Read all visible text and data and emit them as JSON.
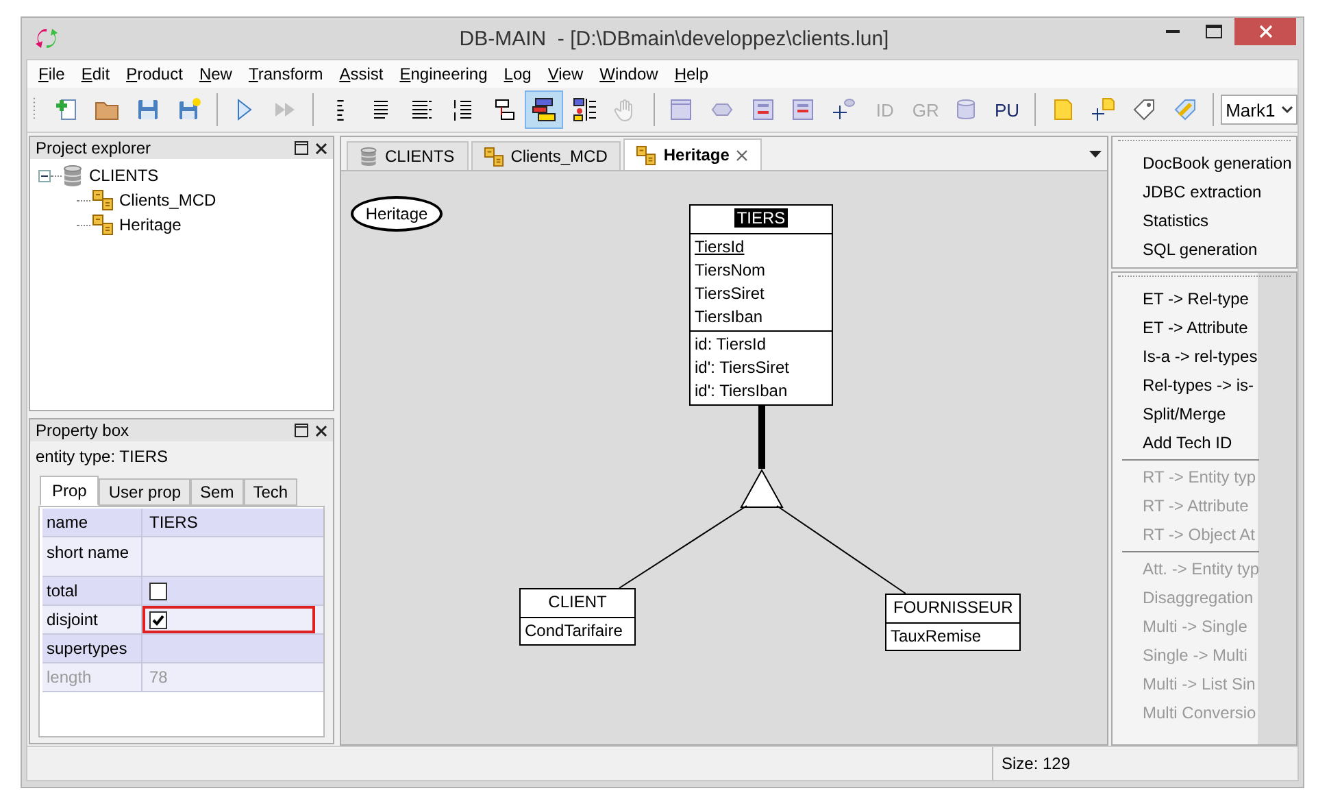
{
  "window": {
    "title": "DB-MAIN  - [D:\\DBmain\\developpez\\clients.lun]"
  },
  "menu": [
    "File",
    "Edit",
    "Product",
    "New",
    "Transform",
    "Assist",
    "Engineering",
    "Log",
    "View",
    "Window",
    "Help"
  ],
  "toolbar": {
    "groups": [
      {
        "buttons": [
          {
            "kind": "icon",
            "selected": false,
            "disabled": false
          },
          {
            "kind": "icon",
            "selected": false,
            "disabled": false
          },
          {
            "kind": "icon",
            "selected": false,
            "disabled": false
          },
          {
            "kind": "icon",
            "selected": false,
            "disabled": false
          }
        ]
      },
      {
        "buttons": [
          {
            "kind": "icon",
            "selected": false,
            "disabled": false
          },
          {
            "kind": "icon",
            "selected": false,
            "disabled": true
          }
        ]
      },
      {
        "buttons": [
          {
            "kind": "icon",
            "selected": false,
            "disabled": false
          },
          {
            "kind": "icon",
            "selected": false,
            "disabled": false
          },
          {
            "kind": "icon",
            "selected": false,
            "disabled": false
          },
          {
            "kind": "icon",
            "selected": false,
            "disabled": false
          },
          {
            "kind": "icon",
            "selected": false,
            "disabled": false
          },
          {
            "kind": "icon",
            "selected": true,
            "disabled": false
          },
          {
            "kind": "icon",
            "selected": false,
            "disabled": false
          },
          {
            "kind": "icon",
            "selected": false,
            "disabled": true
          }
        ]
      },
      {
        "buttons": [
          {
            "kind": "icon",
            "selected": false,
            "disabled": false
          },
          {
            "kind": "icon",
            "selected": false,
            "disabled": false
          },
          {
            "kind": "icon",
            "selected": false,
            "disabled": false
          },
          {
            "kind": "icon",
            "selected": false,
            "disabled": false
          },
          {
            "kind": "icon",
            "selected": false,
            "disabled": false
          },
          {
            "kind": "text",
            "label": "ID",
            "selected": false,
            "disabled": true
          },
          {
            "kind": "text",
            "label": "GR",
            "selected": false,
            "disabled": true
          },
          {
            "kind": "icon",
            "selected": false,
            "disabled": false
          },
          {
            "kind": "text",
            "label": "PU",
            "selected": false,
            "disabled": false
          }
        ]
      },
      {
        "buttons": [
          {
            "kind": "icon",
            "selected": false,
            "disabled": false
          },
          {
            "kind": "icon",
            "selected": false,
            "disabled": false
          },
          {
            "kind": "icon",
            "selected": false,
            "disabled": false
          },
          {
            "kind": "icon",
            "selected": false,
            "disabled": false
          }
        ]
      }
    ],
    "mark_select": {
      "value": "Mark1"
    }
  },
  "project_explorer": {
    "title": "Project explorer",
    "tree": [
      {
        "label": "CLIENTS",
        "expanded": true,
        "children": [
          {
            "label": "Clients_MCD"
          },
          {
            "label": "Heritage"
          }
        ]
      }
    ]
  },
  "property_box": {
    "title": "Property box",
    "subject": "entity type: TIERS",
    "tabs": [
      {
        "label": "Prop",
        "selected": true
      },
      {
        "label": "User prop",
        "selected": false
      },
      {
        "label": "Sem",
        "selected": false
      },
      {
        "label": "Tech",
        "selected": false
      }
    ],
    "rows": [
      {
        "kind": "text",
        "name": "name",
        "value": "TIERS",
        "disabled": false,
        "focused": false
      },
      {
        "kind": "text",
        "name": "short name",
        "disabled": false,
        "focused": false
      },
      {
        "kind": "checkbox",
        "name": "total",
        "checked": false,
        "disabled": false,
        "focused": false
      },
      {
        "kind": "checkbox",
        "name": "disjoint",
        "checked": true,
        "disabled": false,
        "focused": true
      },
      {
        "kind": "text",
        "name": "supertypes",
        "disabled": false,
        "focused": false
      },
      {
        "kind": "text",
        "name": "length",
        "value": "78",
        "disabled": true,
        "focused": false
      }
    ]
  },
  "document_tabs": [
    {
      "kind": "database",
      "label": "CLIENTS",
      "selected": false
    },
    {
      "kind": "schema",
      "label": "Clients_MCD",
      "selected": false
    },
    {
      "kind": "schema",
      "label": "Heritage",
      "selected": true
    }
  ],
  "diagram": {
    "schema_label": "Heritage",
    "entities": [
      {
        "name": "TIERS",
        "selected": true,
        "attributes": [
          {
            "name": "TiersId",
            "identifier": true
          },
          {
            "name": "TiersNom",
            "identifier": false
          },
          {
            "name": "TiersSiret",
            "identifier": false
          },
          {
            "name": "TiersIban",
            "identifier": false
          }
        ],
        "groups": [
          "id: TiersId",
          "id': TiersSiret",
          "id': TiersIban"
        ]
      },
      {
        "name": "CLIENT",
        "selected": false,
        "attributes": [
          {
            "name": "CondTarifaire",
            "identifier": false
          }
        ]
      },
      {
        "name": "FOURNISSEUR",
        "selected": false,
        "attributes": [
          {
            "name": "TauxRemise",
            "identifier": false
          }
        ]
      }
    ]
  },
  "tool_panels": [
    {
      "groups": [
        {
          "items": [
            {
              "label": "DocBook generation",
              "disabled": false
            },
            {
              "label": "JDBC extraction",
              "disabled": false
            },
            {
              "label": "Statistics",
              "disabled": false
            },
            {
              "label": "SQL generation",
              "disabled": false
            }
          ]
        }
      ]
    },
    {
      "groups": [
        {
          "items": [
            {
              "label": "ET -> Rel-type",
              "disabled": false
            },
            {
              "label": "ET -> Attribute",
              "disabled": false
            },
            {
              "label": "Is-a -> rel-types",
              "disabled": false
            },
            {
              "label": "Rel-types -> is-",
              "disabled": false
            },
            {
              "label": "Split/Merge",
              "disabled": false
            },
            {
              "label": "Add Tech ID",
              "disabled": false
            }
          ]
        },
        {
          "items": [
            {
              "label": "RT -> Entity typ",
              "disabled": true
            },
            {
              "label": "RT -> Attribute",
              "disabled": true
            },
            {
              "label": "RT -> Object At",
              "disabled": true
            }
          ]
        },
        {
          "items": [
            {
              "label": "Att. -> Entity typ",
              "disabled": true
            },
            {
              "label": "Disaggregation",
              "disabled": true
            },
            {
              "label": "Multi -> Single",
              "disabled": true
            },
            {
              "label": "Single -> Multi",
              "disabled": true
            },
            {
              "label": "Multi -> List Sin",
              "disabled": true
            },
            {
              "label": "Multi Conversio",
              "disabled": true
            }
          ]
        }
      ]
    }
  ],
  "status_bar": {
    "size": "Size: 129"
  }
}
